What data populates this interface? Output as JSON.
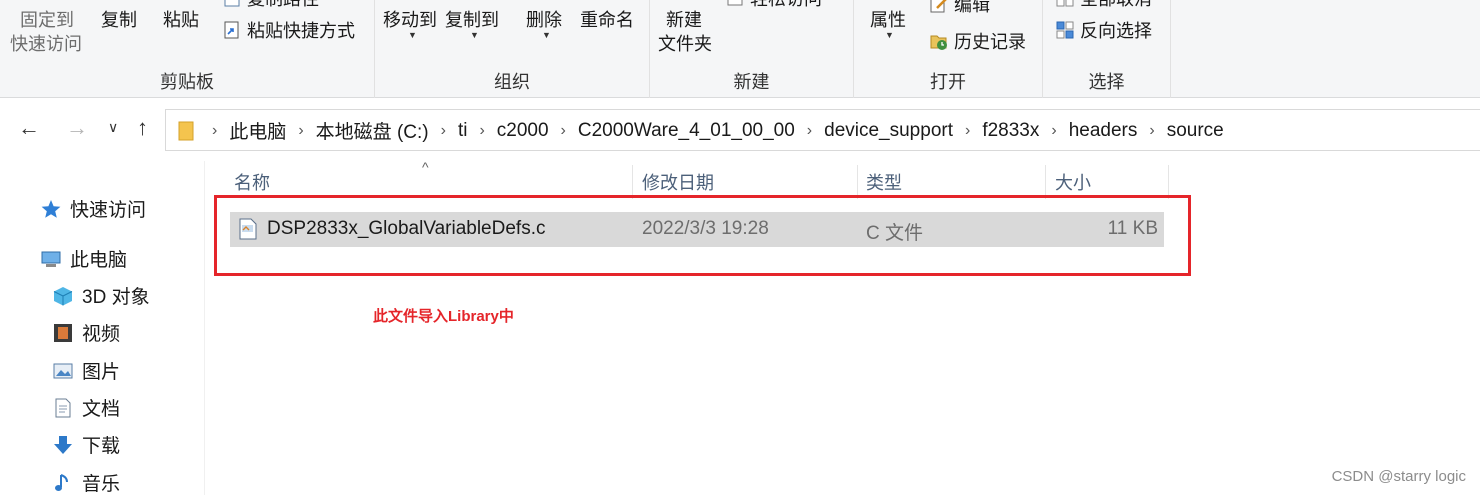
{
  "ribbon": {
    "clipboard": {
      "pin_label_1": "固定到",
      "pin_label_2": "快速访问",
      "copy": "复制",
      "paste": "粘贴",
      "copy_path": "复制路径",
      "paste_shortcut": "粘贴快捷方式",
      "group": "剪贴板"
    },
    "organize": {
      "move_to": "移动到",
      "copy_to": "复制到",
      "delete": "删除",
      "rename": "重命名",
      "group": "组织"
    },
    "new": {
      "new_folder_1": "新建",
      "new_folder_2": "文件夹",
      "easy_access": "轻松访问",
      "group": "新建"
    },
    "open": {
      "properties": "属性",
      "edit": "编辑",
      "history": "历史记录",
      "group": "打开"
    },
    "select": {
      "select_none": "全部取消",
      "invert": "反向选择",
      "group": "选择"
    }
  },
  "address": {
    "crumbs": [
      "此电脑",
      "本地磁盘 (C:)",
      "ti",
      "c2000",
      "C2000Ware_4_01_00_00",
      "device_support",
      "f2833x",
      "headers",
      "source"
    ]
  },
  "sidebar": {
    "quick_access": "快速访问",
    "this_pc": "此电脑",
    "objects3d": "3D 对象",
    "videos": "视频",
    "pictures": "图片",
    "documents": "文档",
    "downloads": "下载",
    "music": "音乐"
  },
  "columns": {
    "name": "名称",
    "modified": "修改日期",
    "type": "类型",
    "size": "大小"
  },
  "file": {
    "name": "DSP2833x_GlobalVariableDefs.c",
    "modified": "2022/3/3 19:28",
    "type": "C 文件",
    "size": "11 KB"
  },
  "annotation": "此文件导入Library中",
  "watermark": "CSDN @starry logic",
  "colors": {
    "highlight": "#e5252a",
    "selection": "#d9d9d9",
    "column_header": "#4c607a"
  }
}
